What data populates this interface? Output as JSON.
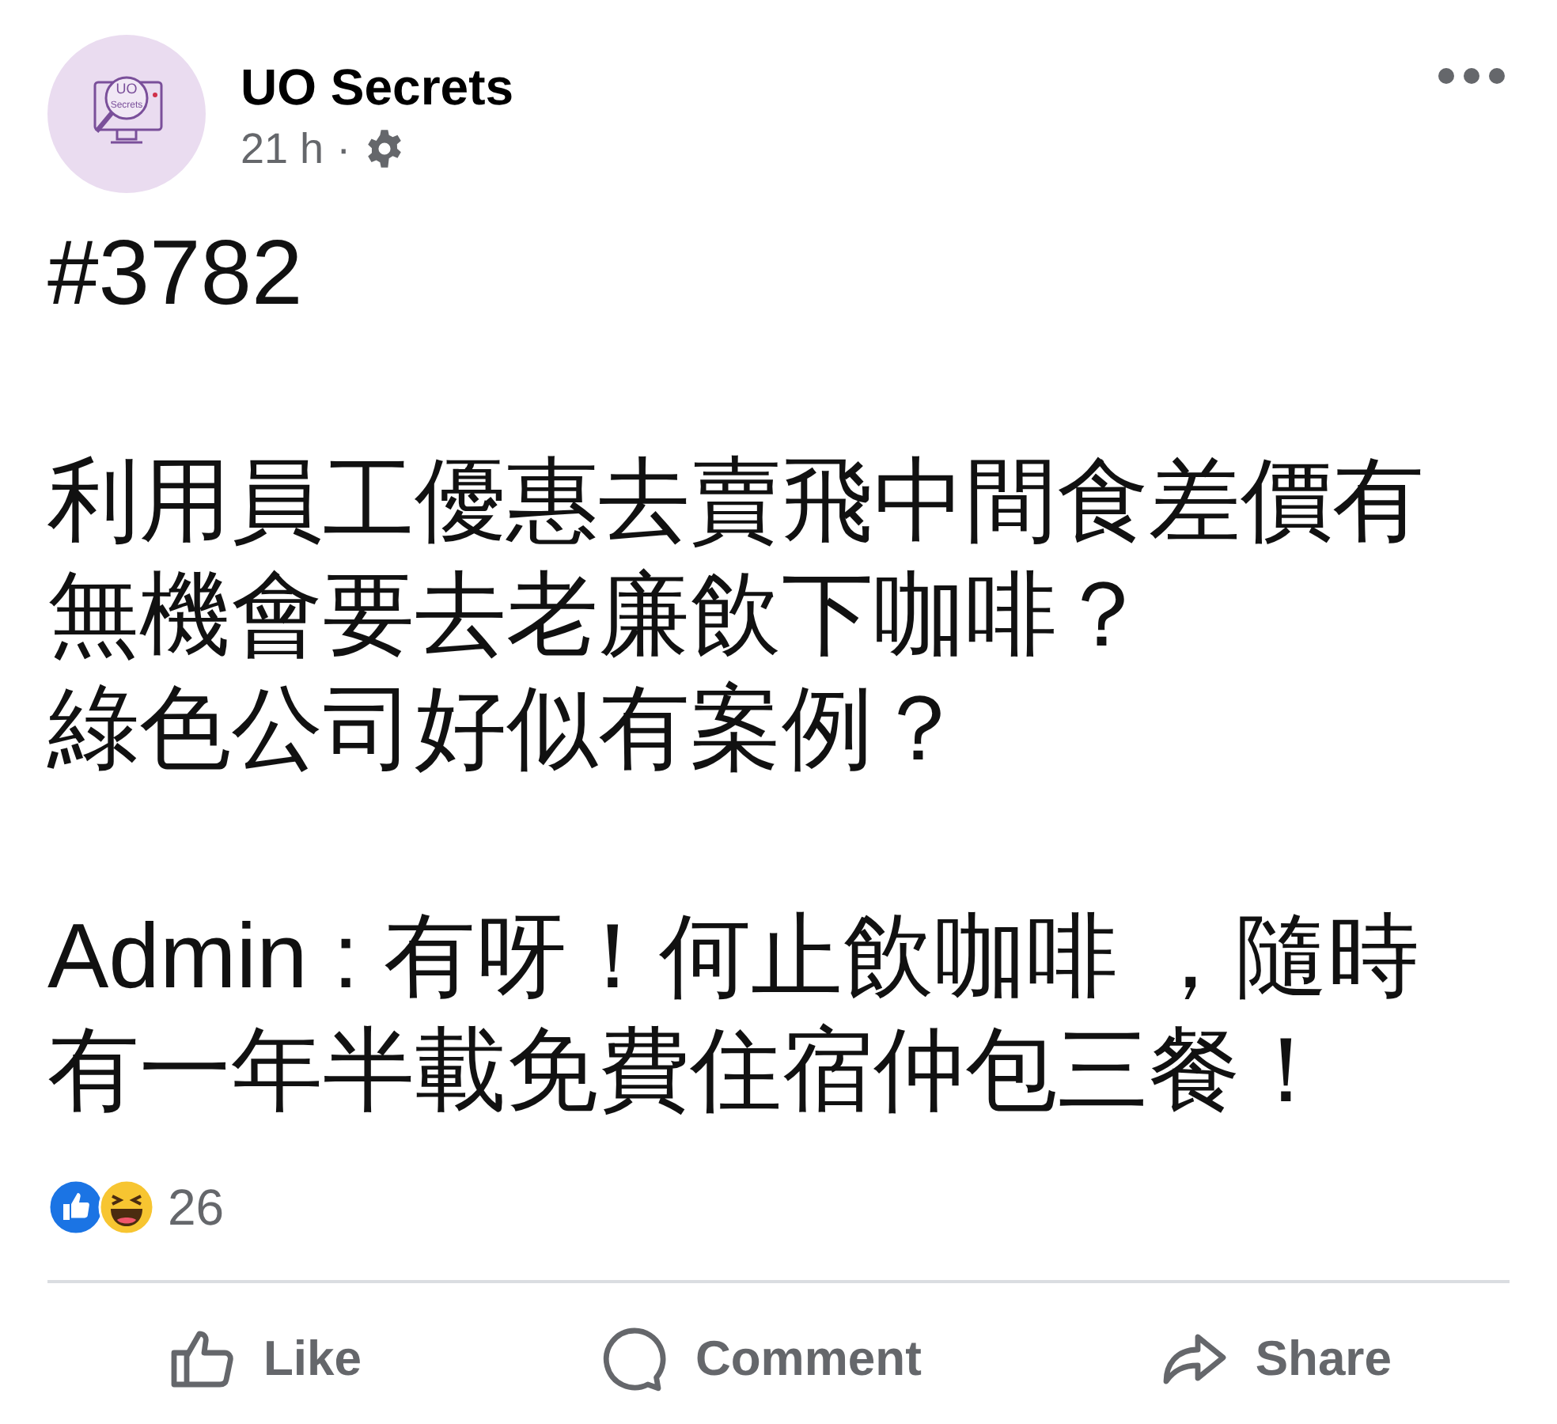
{
  "post": {
    "author": "UO Secrets",
    "avatar_text": [
      "UO",
      "Secrets"
    ],
    "time": "21 h",
    "separator": "·",
    "paragraphs": [
      [
        "#3782"
      ],
      [
        "利用員工優惠去賣飛中間食差價有",
        "無機會要去老廉飲下咖啡？",
        "綠色公司好似有案例？"
      ],
      [
        "Admin : 有呀！何止飲咖啡 ，隨時",
        "有一年半載免費住宿仲包三餐！"
      ]
    ],
    "reaction_count": "26",
    "actions": [
      {
        "kind": "like",
        "label": "Like"
      },
      {
        "kind": "comment",
        "label": "Comment"
      },
      {
        "kind": "share",
        "label": "Share"
      }
    ]
  }
}
